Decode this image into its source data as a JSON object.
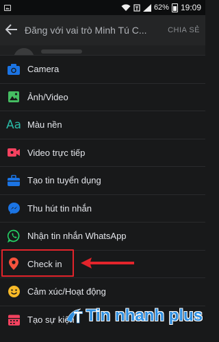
{
  "status_bar": {
    "battery": "62%",
    "time": "19:09"
  },
  "header": {
    "back_icon": "arrow-left-icon",
    "title": "Đăng với vai trò Minh Tú C...",
    "share_label": "CHIA SẺ"
  },
  "menu": [
    {
      "label": "Camera",
      "icon": "camera-icon",
      "color": "#1b74e4"
    },
    {
      "label": "Ảnh/Video",
      "icon": "photo-icon",
      "color": "#45bd62"
    },
    {
      "label": "Màu nền",
      "icon": "text-background-icon",
      "color": "#2abba7"
    },
    {
      "label": "Video trực tiếp",
      "icon": "live-video-icon",
      "color": "#f3425f"
    },
    {
      "label": "Tạo tin tuyển dụng",
      "icon": "briefcase-icon",
      "color": "#1b74e4"
    },
    {
      "label": "Thu hút tin nhắn",
      "icon": "messenger-icon",
      "color": "#1b74e4"
    },
    {
      "label": "Nhận tin nhắn WhatsApp",
      "icon": "whatsapp-icon",
      "color": "#25d366"
    },
    {
      "label": "Check in",
      "icon": "location-pin-icon",
      "color": "#f5533d"
    },
    {
      "label": "Cảm xúc/Hoạt động",
      "icon": "smile-icon",
      "color": "#f7b928"
    },
    {
      "label": "Tạo sự kiện",
      "icon": "calendar-icon",
      "color": "#f3425f"
    }
  ],
  "annotation": {
    "highlight_color": "#e3242b"
  },
  "watermark": {
    "text": "Tin nhanh plus",
    "color": "#2f8fe0"
  }
}
